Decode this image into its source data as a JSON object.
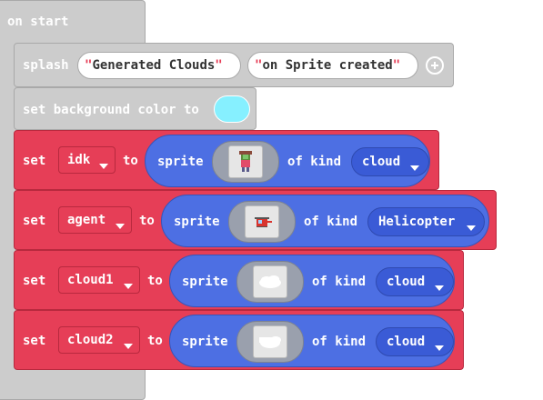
{
  "event": {
    "label": "on start"
  },
  "splash": {
    "label": "splash",
    "arg1": "Generated Clouds",
    "arg2": "on Sprite created",
    "add_icon": "plus-circle-icon"
  },
  "bg": {
    "label": "set background color to",
    "color": "#86f0ff"
  },
  "rows": [
    {
      "set": "set",
      "var": "idk",
      "to": "to",
      "sprite": "sprite",
      "of_kind": "of kind",
      "kind": "cloud",
      "image": "person-sprite"
    },
    {
      "set": "set",
      "var": "agent",
      "to": "to",
      "sprite": "sprite",
      "of_kind": "of kind",
      "kind": "Helicopter",
      "image": "helicopter-sprite"
    },
    {
      "set": "set",
      "var": "cloud1",
      "to": "to",
      "sprite": "sprite",
      "of_kind": "of kind",
      "kind": "cloud",
      "image": "cloud-sprite"
    },
    {
      "set": "set",
      "var": "cloud2",
      "to": "to",
      "sprite": "sprite",
      "of_kind": "of kind",
      "kind": "cloud",
      "image": "cloud-sprite"
    }
  ],
  "colors": {
    "event_gray": "#cccccc",
    "set_red": "#e63e57",
    "sprite_blue": "#4d6fe3",
    "kind_blue": "#3a5bd6"
  }
}
